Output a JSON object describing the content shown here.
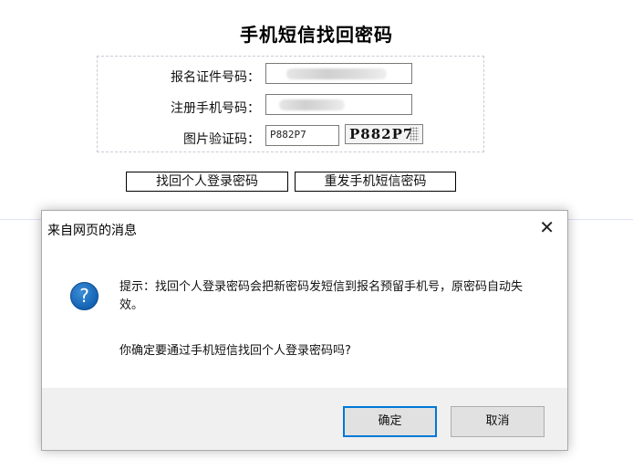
{
  "page": {
    "title": "手机短信找回密码",
    "form": {
      "id_label": "报名证件号码：",
      "phone_label": "注册手机号码：",
      "captcha_label": "图片验证码：",
      "captcha_value": "P882P7",
      "captcha_image_text": "P882P7"
    },
    "buttons": {
      "recover": "找回个人登录密码",
      "resend": "重发手机短信密码"
    }
  },
  "dialog": {
    "title": "来自网页的消息",
    "close_glyph": "✕",
    "icon_glyph": "?",
    "message": "提示：找回个人登录密码会把新密码发短信到报名预留手机号，原密码自动失效。",
    "question": "你确定要通过手机短信找回个人登录密码吗?",
    "ok_label": "确定",
    "cancel_label": "取消"
  },
  "icons": {
    "dialog_icon": "question-icon",
    "close": "close-icon"
  },
  "colors": {
    "primary_border": "#0078d7",
    "icon_blue": "#1462b3"
  }
}
